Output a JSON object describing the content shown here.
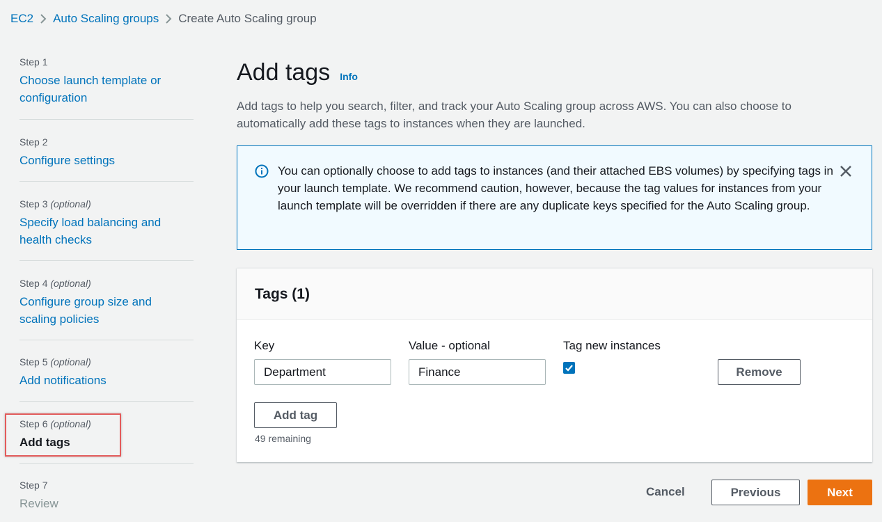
{
  "breadcrumb": {
    "items": [
      "EC2",
      "Auto Scaling groups"
    ],
    "current": "Create Auto Scaling group"
  },
  "steps": [
    {
      "label": "Step 1",
      "optional": "",
      "title": "Choose launch template or configuration",
      "state": "link"
    },
    {
      "label": "Step 2",
      "optional": "",
      "title": "Configure settings",
      "state": "link"
    },
    {
      "label": "Step 3",
      "optional": "(optional)",
      "title": "Specify load balancing and health checks",
      "state": "link"
    },
    {
      "label": "Step 4",
      "optional": "(optional)",
      "title": "Configure group size and scaling policies",
      "state": "link"
    },
    {
      "label": "Step 5",
      "optional": "(optional)",
      "title": "Add notifications",
      "state": "link"
    },
    {
      "label": "Step 6",
      "optional": "(optional)",
      "title": "Add tags",
      "state": "current"
    },
    {
      "label": "Step 7",
      "optional": "",
      "title": "Review",
      "state": "disabled"
    }
  ],
  "page": {
    "title": "Add tags",
    "info_link": "Info",
    "description": "Add tags to help you search, filter, and track your Auto Scaling group across AWS. You can also choose to automatically add these tags to instances when they are launched."
  },
  "alert": {
    "icon": "info-circle-icon",
    "text": "You can optionally choose to add tags to instances (and their attached EBS volumes) by specifying tags in your launch template. We recommend caution, however, because the tag values for instances from your launch template will be overridden if there are any duplicate keys specified for the Auto Scaling group."
  },
  "tags_panel": {
    "title": "Tags (1)",
    "columns": {
      "key": "Key",
      "value": "Value - optional",
      "tag_new": "Tag new instances"
    },
    "rows": [
      {
        "key": "Department",
        "value": "Finance",
        "tag_new_instances": true,
        "remove_label": "Remove"
      }
    ],
    "add_tag_label": "Add tag",
    "remaining": "49 remaining"
  },
  "footer": {
    "cancel": "Cancel",
    "previous": "Previous",
    "next": "Next"
  },
  "colors": {
    "link": "#0073bb",
    "primary": "#ec7211",
    "highlight": "#e35b5b"
  }
}
